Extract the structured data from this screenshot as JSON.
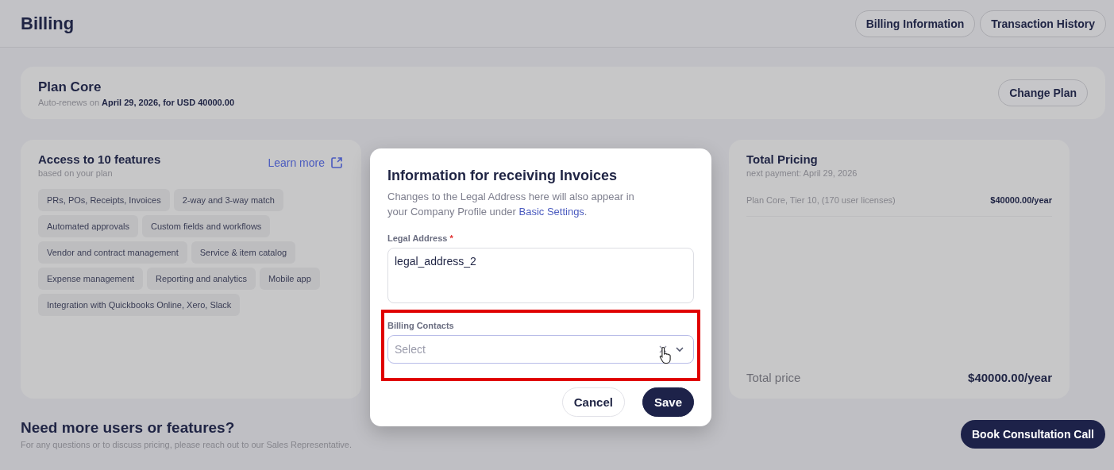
{
  "header": {
    "title": "Billing",
    "buttons": [
      "Billing Information",
      "Transaction History"
    ]
  },
  "plan": {
    "title": "Plan Core",
    "renew_prefix": "Auto-renews on",
    "renew_detail": "April 29, 2026, for USD 40000.00",
    "button": "Change Plan"
  },
  "features": {
    "title": "Access to 10 features",
    "subtitle": "based on your plan",
    "link": "Learn more",
    "tags": [
      "PRs, POs, Receipts, Invoices",
      "2-way and 3-way match",
      "Automated approvals",
      "Custom fields and workflows",
      "Vendor and contract management",
      "Service & item catalog",
      "Expense management",
      "Reporting and analytics",
      "Mobile app",
      "Integration with Quickbooks Online, Xero, Slack"
    ]
  },
  "pricing": {
    "title": "Total Pricing",
    "subtitle": "next payment: April 29, 2026",
    "lines": [
      {
        "label": "Plan Core, Tier 10, (170 user licenses)",
        "amount": "$40000.00/year"
      }
    ],
    "total_label": "Total price",
    "total_amount": "$40000.00/year"
  },
  "contact": {
    "title": "Need more users or features?",
    "text": "For any questions or to discuss pricing, please reach out to our Sales Representative.",
    "button": "Book Consultation Call"
  },
  "modal": {
    "title": "Information for receiving Invoices",
    "description": "Changes to the Legal Address here will also appear in your Company Profile under",
    "link": "Basic Settings",
    "link_suffix": ".",
    "legal_address": {
      "label": "Legal Address",
      "required_mark": "*",
      "value": "legal_address_2"
    },
    "billing_contacts": {
      "label": "Billing Contacts",
      "placeholder": "Select",
      "highlighted": true
    },
    "buttons": [
      {
        "label": "Cancel",
        "kind": "secondary"
      },
      {
        "label": "Save",
        "kind": "primary"
      }
    ]
  }
}
